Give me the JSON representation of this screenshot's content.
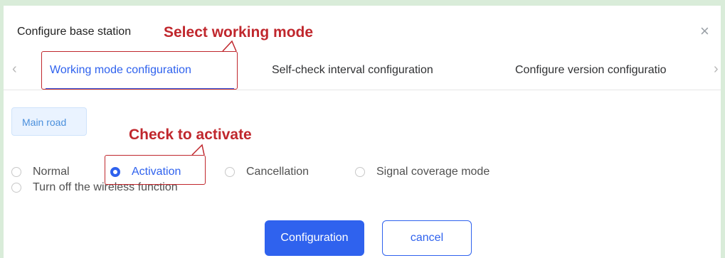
{
  "dialog": {
    "title": "Configure base station",
    "close_glyph": "×"
  },
  "tabs": {
    "prev_glyph": "‹",
    "next_glyph": "›",
    "items": [
      {
        "label": "Working mode configuration",
        "active": true
      },
      {
        "label": "Self-check interval configuration",
        "active": false
      },
      {
        "label": "Configure version configuratio",
        "active": false
      }
    ]
  },
  "chip": {
    "label": "Main road"
  },
  "modes": [
    {
      "label": "Normal",
      "checked": false
    },
    {
      "label": "Activation",
      "checked": true
    },
    {
      "label": "Cancellation",
      "checked": false
    },
    {
      "label": "Signal coverage mode",
      "checked": false
    },
    {
      "label": "Turn off the wireless function",
      "checked": false
    }
  ],
  "buttons": {
    "confirm": "Configuration",
    "cancel": "cancel"
  },
  "annotations": {
    "select_mode": "Select working mode",
    "check_activate": "Check to activate"
  },
  "colors": {
    "accent": "#2f62ee",
    "annotation": "#c0272d",
    "background": "#d9ecd9"
  }
}
